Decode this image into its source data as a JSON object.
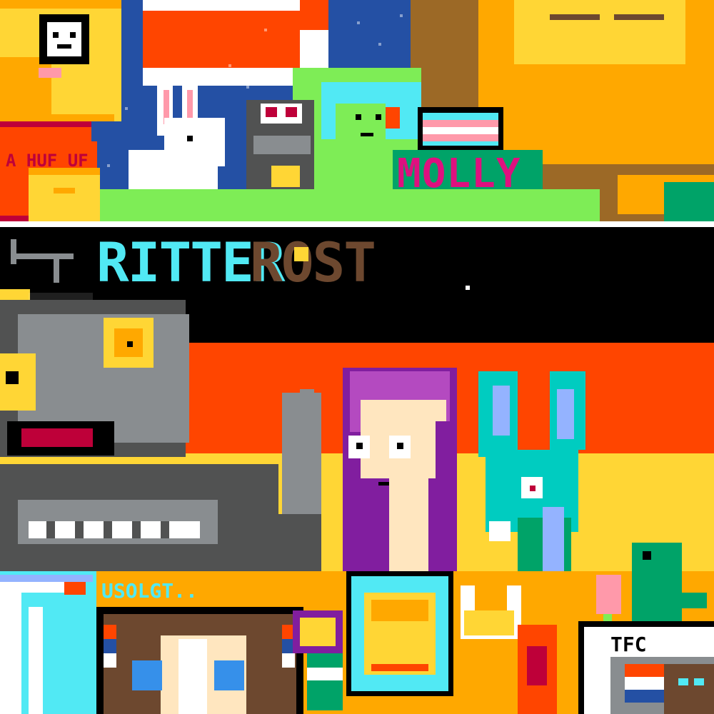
{
  "artwork": {
    "style": "collaborative pixel-art canvas",
    "labels": {
      "molly": "MOLLY",
      "ritter": "RITTER",
      "rost": "ROST",
      "tfc": "TFC",
      "partial_tag": "USOLGT..",
      "red_badge_text": "A  HUF UF"
    }
  },
  "palette": {
    "orange": "#ff4500",
    "yellow": "#ffd635",
    "gold": "#ffa800",
    "blue": "#2450a4",
    "green": "#7eed56",
    "cyan": "#51e9f4",
    "teal": "#00a368",
    "purple": "#811e9f",
    "pink": "#ff99aa",
    "gray": "#898d90",
    "black": "#000000",
    "white": "#ffffff",
    "brown": "#6d482f"
  }
}
